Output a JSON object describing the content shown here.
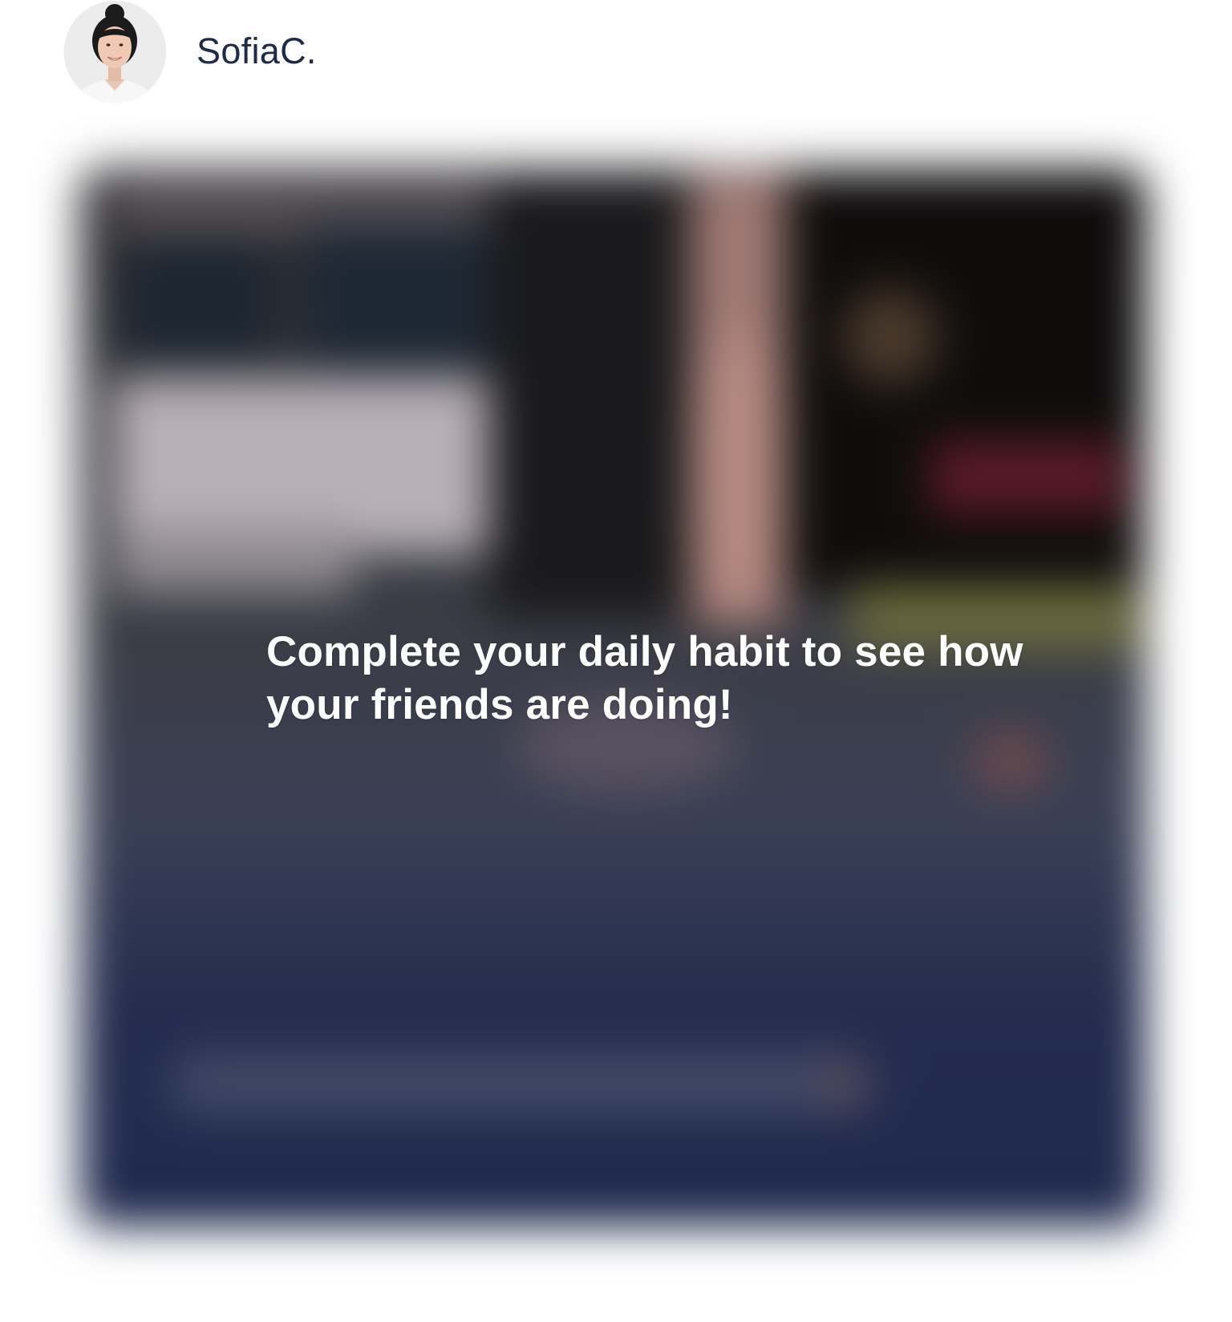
{
  "post": {
    "author": {
      "name": "SofiaC.",
      "avatar_icon": "user-avatar-photo"
    },
    "media": {
      "state": "locked-blurred",
      "overlay_message": "Complete your daily habit to see how your friends are doing!"
    }
  },
  "colors": {
    "username_text": "#1e2a4a",
    "overlay_text": "#ffffff",
    "media_bottom": "#1f2a4d",
    "background": "#ffffff"
  }
}
